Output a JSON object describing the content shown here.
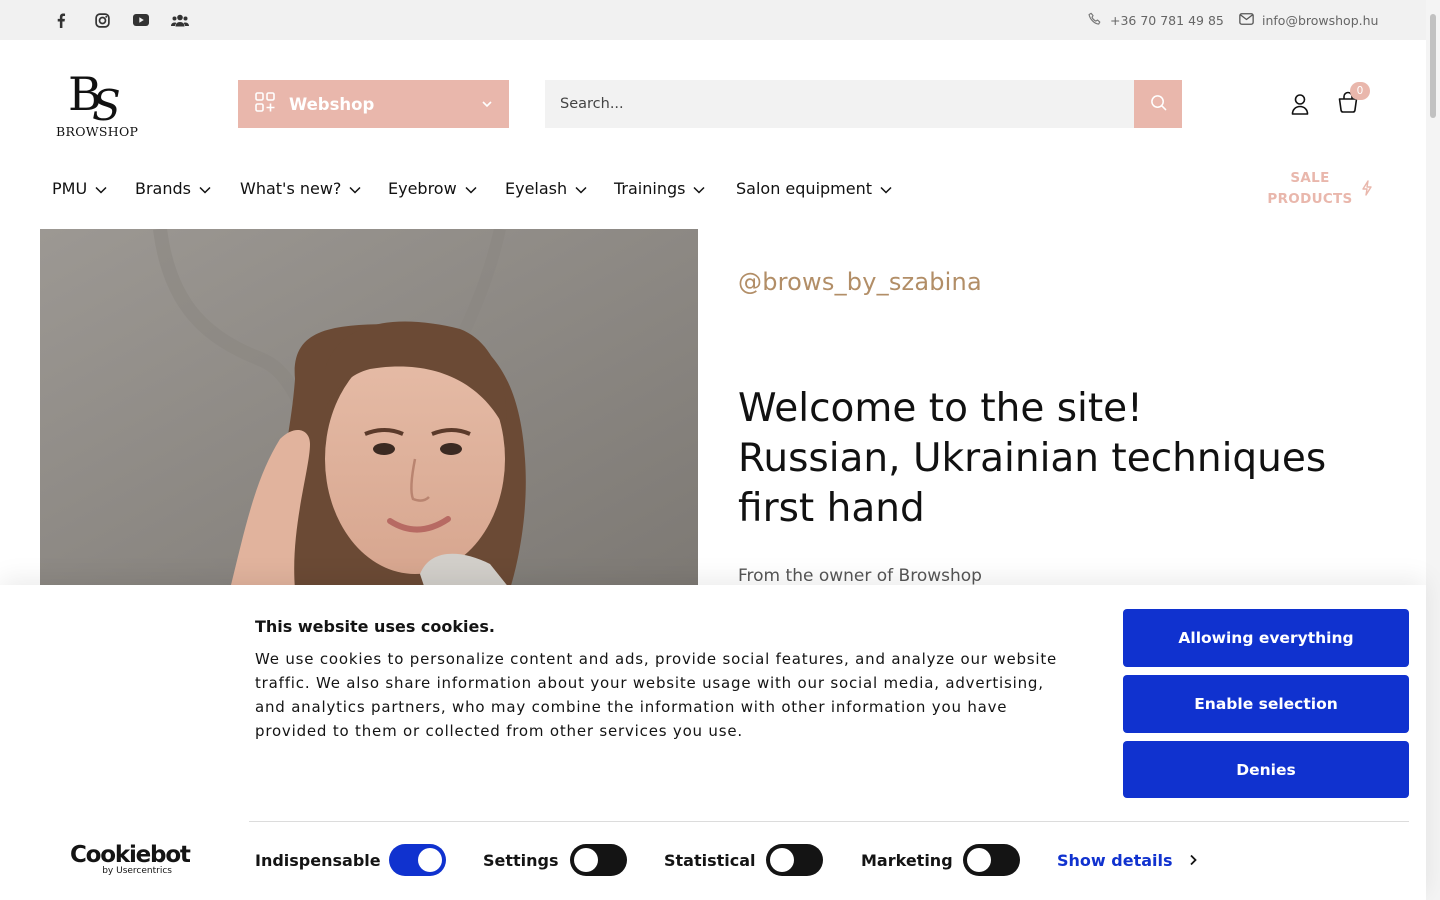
{
  "topbar": {
    "social_icons": [
      "facebook-icon",
      "instagram-icon",
      "youtube-icon",
      "community-icon"
    ],
    "phone": "+36 70 781 49 85",
    "email": "info@browshop.hu"
  },
  "header": {
    "logo_text": "BROWSHOP",
    "webshop_label": "Webshop",
    "search_placeholder": "Search...",
    "cart_count": "0"
  },
  "nav": {
    "items": [
      {
        "label": "PMU"
      },
      {
        "label": "Brands"
      },
      {
        "label": "What's new?"
      },
      {
        "label": "Eyebrow"
      },
      {
        "label": "Eyelash"
      },
      {
        "label": "Trainings"
      },
      {
        "label": "Salon equipment"
      }
    ],
    "sale_line1": "SALE",
    "sale_line2": "PRODUCTS"
  },
  "hero": {
    "handle": "@brows_by_szabina",
    "headline_lines": [
      "Welcome to the site!",
      "Russian, Ukrainian techniques",
      "first hand"
    ],
    "subtitle": "From the owner of Browshop"
  },
  "cookie": {
    "title": "This website uses cookies.",
    "text": "We use cookies to personalize content and ads, provide social features, and analyze our website traffic. We also share information about your website usage with our social media, advertising, and analytics partners, who may combine the information with other information you have provided to them or collected from other services you use.",
    "buttons": {
      "allow_all": "Allowing everything",
      "enable_selection": "Enable selection",
      "deny": "Denies"
    },
    "brand": "Cookiebot",
    "brand_sub": "by Usercentrics",
    "toggles": [
      {
        "label": "Indispensable",
        "on": true
      },
      {
        "label": "Settings",
        "on": false
      },
      {
        "label": "Statistical",
        "on": false
      },
      {
        "label": "Marketing",
        "on": false
      }
    ],
    "show_details": "Show details"
  },
  "colors": {
    "accent_pink": "#e9b7ac",
    "handle_gold": "#b28e67",
    "cookie_blue": "#1032cf"
  }
}
